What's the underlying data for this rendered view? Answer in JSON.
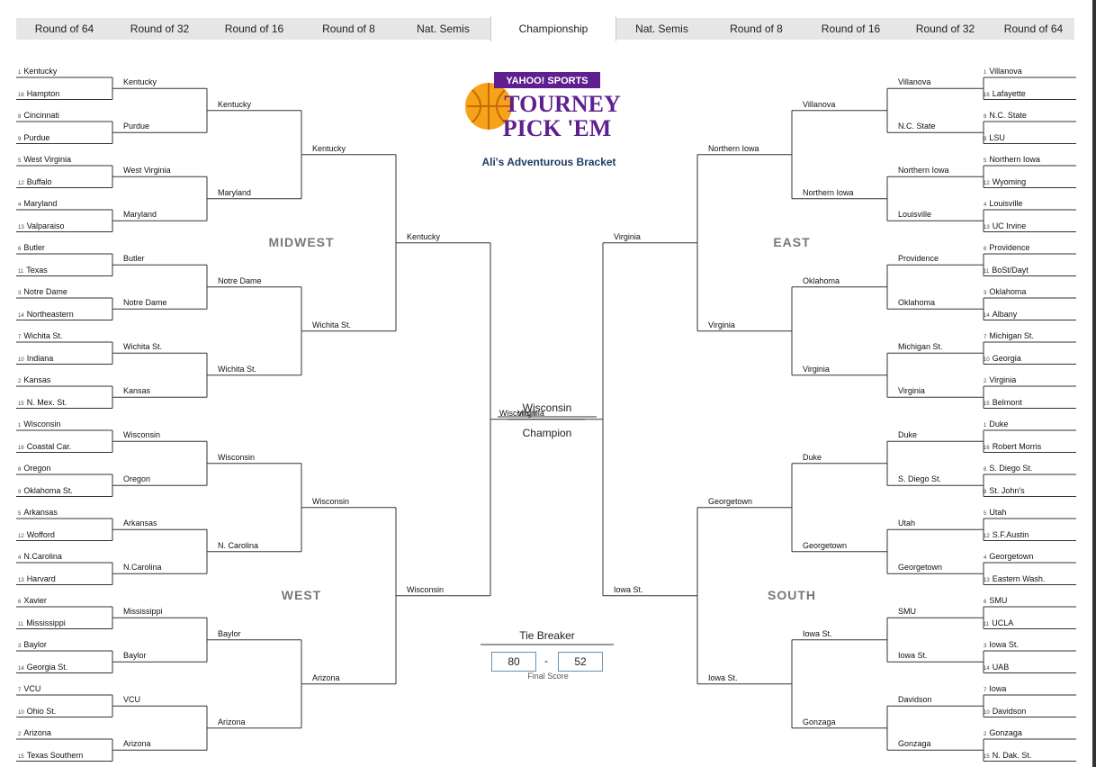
{
  "rounds": [
    "Round of 64",
    "Round of 32",
    "Round of 16",
    "Round of 8",
    "Nat. Semis",
    "Championship",
    "Nat. Semis",
    "Round of 8",
    "Round of 16",
    "Round of 32",
    "Round of 64"
  ],
  "logo": {
    "top": "YAHOO! SPORTS",
    "line1": "TOURNEY",
    "line2": "PICK 'EM"
  },
  "subtitle": "Ali's Adventurous Bracket",
  "regions": {
    "midwest": "MIDWEST",
    "west": "WEST",
    "east": "EAST",
    "south": "SOUTH"
  },
  "left_r64": [
    {
      "seed": "1",
      "team": "Kentucky"
    },
    {
      "seed": "16",
      "team": "Hampton"
    },
    {
      "seed": "8",
      "team": "Cincinnati"
    },
    {
      "seed": "9",
      "team": "Purdue"
    },
    {
      "seed": "5",
      "team": "West Virginia"
    },
    {
      "seed": "12",
      "team": "Buffalo"
    },
    {
      "seed": "4",
      "team": "Maryland"
    },
    {
      "seed": "13",
      "team": "Valparaiso"
    },
    {
      "seed": "6",
      "team": "Butler"
    },
    {
      "seed": "11",
      "team": "Texas"
    },
    {
      "seed": "3",
      "team": "Notre Dame"
    },
    {
      "seed": "14",
      "team": "Northeastern"
    },
    {
      "seed": "7",
      "team": "Wichita St."
    },
    {
      "seed": "10",
      "team": "Indiana"
    },
    {
      "seed": "2",
      "team": "Kansas"
    },
    {
      "seed": "15",
      "team": "N. Mex. St."
    },
    {
      "seed": "1",
      "team": "Wisconsin"
    },
    {
      "seed": "16",
      "team": "Coastal Car."
    },
    {
      "seed": "8",
      "team": "Oregon"
    },
    {
      "seed": "9",
      "team": "Oklahoma St."
    },
    {
      "seed": "5",
      "team": "Arkansas"
    },
    {
      "seed": "12",
      "team": "Wofford"
    },
    {
      "seed": "4",
      "team": "N.Carolina"
    },
    {
      "seed": "13",
      "team": "Harvard"
    },
    {
      "seed": "6",
      "team": "Xavier"
    },
    {
      "seed": "11",
      "team": "Mississippi"
    },
    {
      "seed": "3",
      "team": "Baylor"
    },
    {
      "seed": "14",
      "team": "Georgia St."
    },
    {
      "seed": "7",
      "team": "VCU"
    },
    {
      "seed": "10",
      "team": "Ohio St."
    },
    {
      "seed": "2",
      "team": "Arizona"
    },
    {
      "seed": "15",
      "team": "Texas Southern"
    }
  ],
  "left_r32": [
    "Kentucky",
    "Purdue",
    "West Virginia",
    "Maryland",
    "Butler",
    "Notre Dame",
    "Wichita St.",
    "Kansas",
    "Wisconsin",
    "Oregon",
    "Arkansas",
    "N.Carolina",
    "Mississippi",
    "Baylor",
    "VCU",
    "Arizona"
  ],
  "left_r16": [
    "Kentucky",
    "Maryland",
    "Notre Dame",
    "Wichita St.",
    "Wisconsin",
    "N. Carolina",
    "Baylor",
    "Arizona"
  ],
  "left_r8": [
    "Kentucky",
    "Wichita St.",
    "Wisconsin",
    "Arizona"
  ],
  "left_semi": [
    "Kentucky",
    "Wisconsin"
  ],
  "left_final": "Wisconsin",
  "right_r64": [
    {
      "seed": "1",
      "team": "Villanova"
    },
    {
      "seed": "16",
      "team": "Lafayette"
    },
    {
      "seed": "8",
      "team": "N.C. State"
    },
    {
      "seed": "9",
      "team": "LSU"
    },
    {
      "seed": "5",
      "team": "Northern Iowa"
    },
    {
      "seed": "12",
      "team": "Wyoming"
    },
    {
      "seed": "4",
      "team": "Louisville"
    },
    {
      "seed": "13",
      "team": "UC Irvine"
    },
    {
      "seed": "6",
      "team": "Providence"
    },
    {
      "seed": "11",
      "team": "BoSt/Dayt"
    },
    {
      "seed": "3",
      "team": "Oklahoma"
    },
    {
      "seed": "14",
      "team": "Albany"
    },
    {
      "seed": "7",
      "team": "Michigan St."
    },
    {
      "seed": "10",
      "team": "Georgia"
    },
    {
      "seed": "2",
      "team": "Virginia"
    },
    {
      "seed": "15",
      "team": "Belmont"
    },
    {
      "seed": "1",
      "team": "Duke"
    },
    {
      "seed": "16",
      "team": "Robert Morris"
    },
    {
      "seed": "8",
      "team": "S. Diego St."
    },
    {
      "seed": "9",
      "team": "St. John's"
    },
    {
      "seed": "5",
      "team": "Utah"
    },
    {
      "seed": "12",
      "team": "S.F.Austin"
    },
    {
      "seed": "4",
      "team": "Georgetown"
    },
    {
      "seed": "13",
      "team": "Eastern Wash."
    },
    {
      "seed": "6",
      "team": "SMU"
    },
    {
      "seed": "11",
      "team": "UCLA"
    },
    {
      "seed": "3",
      "team": "Iowa St."
    },
    {
      "seed": "14",
      "team": "UAB"
    },
    {
      "seed": "7",
      "team": "Iowa"
    },
    {
      "seed": "10",
      "team": "Davidson"
    },
    {
      "seed": "2",
      "team": "Gonzaga"
    },
    {
      "seed": "15",
      "team": "N. Dak. St."
    }
  ],
  "right_r32": [
    "Villanova",
    "N.C. State",
    "Northern Iowa",
    "Louisville",
    "Providence",
    "Oklahoma",
    "Michigan St.",
    "Virginia",
    "Duke",
    "S. Diego St.",
    "Utah",
    "Georgetown",
    "SMU",
    "Iowa St.",
    "Davidson",
    "Gonzaga"
  ],
  "right_r16": [
    "Villanova",
    "Northern Iowa",
    "Oklahoma",
    "Virginia",
    "Duke",
    "Georgetown",
    "Iowa St.",
    "Gonzaga"
  ],
  "right_r8": [
    "Northern Iowa",
    "Virginia",
    "Georgetown",
    "Iowa St."
  ],
  "right_semi": [
    "Virginia",
    "Iowa St."
  ],
  "right_final": "Virginia",
  "champion": {
    "name": "Wisconsin",
    "label": "Champion"
  },
  "tiebreaker": {
    "title": "Tie Breaker",
    "score1": "80",
    "dash": "-",
    "score2": "52",
    "label": "Final Score"
  }
}
